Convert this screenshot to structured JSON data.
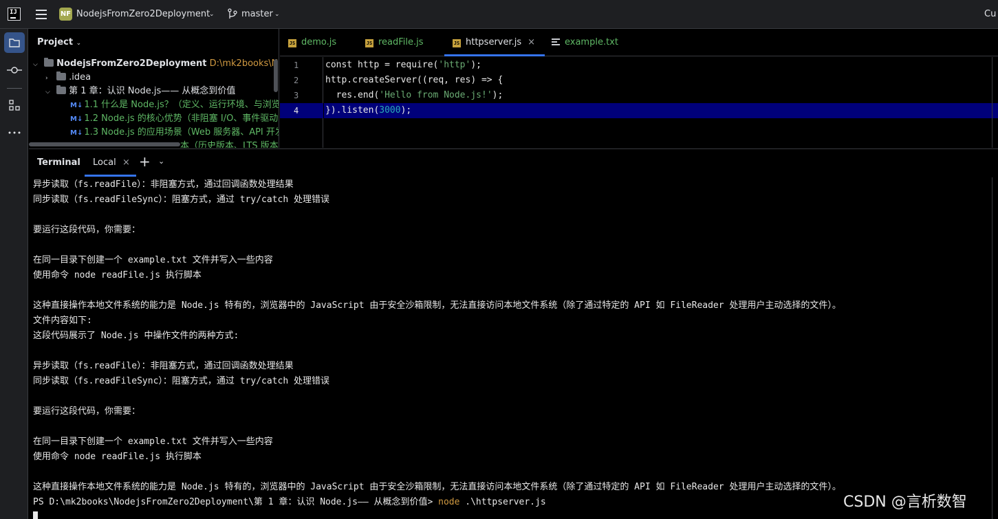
{
  "titlebar": {
    "logo": "IJ",
    "project_badge": "NF",
    "project_name": "NodejsFromZero2Deployment",
    "branch": "master",
    "cut_text": "Cu"
  },
  "project_panel": {
    "title": "Project",
    "root_name": "NodejsFromZero2Deployment",
    "root_path": "D:\\mk2books\\Node",
    "items": [
      {
        "label": ".idea"
      },
      {
        "label": "第 1 章：认识 Node.js—— 从概念到价值"
      },
      {
        "label": "1.1 什么是 Node.js？（定义、运行环境、与浏览器"
      },
      {
        "label": "1.2 Node.js 的核心优势（非阻塞 I/O、事件驱动、"
      },
      {
        "label": "1.3 Node.js 的应用场景（Web 服务器、API 开发"
      },
      {
        "label": "本（历史版本、LTS 版本"
      }
    ]
  },
  "editor": {
    "tabs": [
      {
        "label": "demo.js",
        "icon": "js-file-icon"
      },
      {
        "label": "readFile.js",
        "icon": "js-file-icon"
      },
      {
        "label": "httpserver.js",
        "icon": "js-file-icon",
        "active": true
      },
      {
        "label": "example.txt",
        "icon": "text-file-icon"
      }
    ],
    "line_numbers": [
      "1",
      "2",
      "3",
      "4"
    ],
    "code": {
      "l1_a": "const http = require(",
      "l1_b": "'http'",
      "l1_c": ");",
      "l2": "http.createServer((req, res) => {",
      "l3_a": "  res.end(",
      "l3_b": "'Hello from Node.js!'",
      "l3_c": ");",
      "l4_a": "}).listen(",
      "l4_b": "3000",
      "l4_c": ");"
    },
    "current_line": 4
  },
  "terminal": {
    "title": "Terminal",
    "tab": "Local",
    "lines": [
      "异步读取（fs.readFile）：非阻塞方式，通过回调函数处理结果",
      "同步读取（fs.readFileSync）：阻塞方式，通过 try/catch 处理错误",
      "",
      "要运行这段代码，你需要：",
      "",
      "在同一目录下创建一个 example.txt 文件并写入一些内容",
      "使用命令 node readFile.js 执行脚本",
      "",
      "这种直接操作本地文件系统的能力是 Node.js 特有的，浏览器中的 JavaScript 由于安全沙箱限制，无法直接访问本地文件系统（除了通过特定的 API 如 FileReader 处理用户主动选择的文件）。",
      "文件内容如下:",
      "这段代码展示了 Node.js 中操作文件的两种方式:",
      "",
      "异步读取（fs.readFile）：非阻塞方式，通过回调函数处理结果",
      "同步读取（fs.readFileSync）：阻塞方式，通过 try/catch 处理错误",
      "",
      "要运行这段代码，你需要：",
      "",
      "在同一目录下创建一个 example.txt 文件并写入一些内容",
      "使用命令 node readFile.js 执行脚本",
      "",
      "这种直接操作本地文件系统的能力是 Node.js 特有的，浏览器中的 JavaScript 由于安全沙箱限制，无法直接访问本地文件系统（除了通过特定的 API 如 FileReader 处理用户主动选择的文件）。"
    ],
    "prompt": "PS D:\\mk2books\\NodejsFromZero2Deployment\\第 1 章：认识 Node.js—— 从概念到价值> ",
    "command": "node",
    "command_arg": " .\\httpserver.js"
  },
  "watermark": "CSDN @言析数智",
  "colors": {
    "accent": "#3574f0",
    "current_line": "#00007a",
    "string": "#6aab73",
    "number": "#2aacb8",
    "md_file": "#5fb865",
    "command": "#d19a41"
  }
}
